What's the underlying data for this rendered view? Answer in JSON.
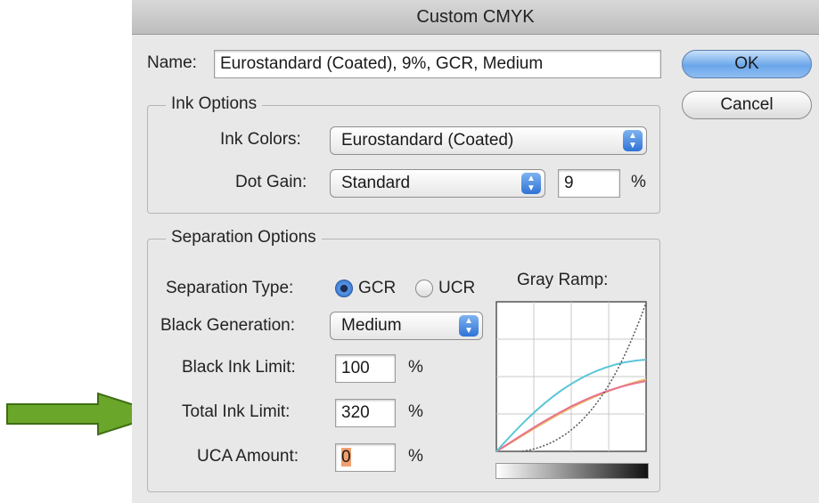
{
  "dialog": {
    "title": "Custom CMYK",
    "name_label": "Name:",
    "name_value": "Eurostandard (Coated), 9%, GCR, Medium",
    "ok_label": "OK",
    "cancel_label": "Cancel"
  },
  "ink_options": {
    "legend": "Ink Options",
    "ink_colors_label": "Ink Colors:",
    "ink_colors_value": "Eurostandard (Coated)",
    "dot_gain_label": "Dot Gain:",
    "dot_gain_value": "Standard",
    "dot_gain_amount": "9",
    "percent": "%"
  },
  "separation": {
    "legend": "Separation Options",
    "type_label": "Separation Type:",
    "gcr_label": "GCR",
    "ucr_label": "UCR",
    "selected_type": "GCR",
    "black_generation_label": "Black Generation:",
    "black_generation_value": "Medium",
    "black_ink_limit_label": "Black Ink Limit:",
    "black_ink_limit_value": "100",
    "total_ink_limit_label": "Total Ink Limit:",
    "total_ink_limit_value": "320",
    "uca_label": "UCA Amount:",
    "uca_value": "0",
    "percent": "%"
  },
  "gray_ramp": {
    "label": "Gray Ramp:",
    "curve_colors": {
      "cyan": "#5bc6d8",
      "magenta": "#e9718f",
      "yellow": "#e8c06a",
      "black": "#555555"
    }
  },
  "annotation": {
    "arrow_color": "#6aa62a"
  }
}
